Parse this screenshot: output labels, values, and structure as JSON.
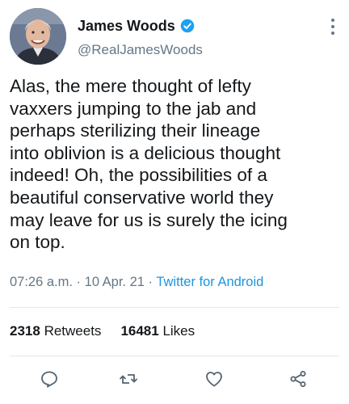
{
  "author": {
    "display_name": "James Woods",
    "handle": "@RealJamesWoods",
    "verified": true
  },
  "icons": {
    "verified": "verified-badge-icon",
    "more": "more-options-icon",
    "reply": "reply-icon",
    "retweet": "retweet-icon",
    "like": "like-icon",
    "share": "share-icon"
  },
  "colors": {
    "text": "#14171a",
    "secondary": "#657786",
    "link": "#1b95e0",
    "verified": "#1da1f2",
    "divider": "#e1e8ed"
  },
  "tweet": {
    "lines": [
      "Alas, the mere thought of lefty",
      "vaxxers jumping to the jab and",
      "perhaps sterilizing their lineage",
      "into oblivion is a delicious thought",
      "indeed! Oh, the possibilities of a",
      "beautiful conservative world they",
      "may leave for us is surely the icing",
      "on top."
    ]
  },
  "meta": {
    "time": "07:26 a.m.",
    "separator": " · ",
    "date": "10 Apr. 21",
    "source": "Twitter for Android"
  },
  "stats": {
    "retweets_count": "2318",
    "retweets_label": "Retweets",
    "likes_count": "16481",
    "likes_label": "Likes"
  }
}
